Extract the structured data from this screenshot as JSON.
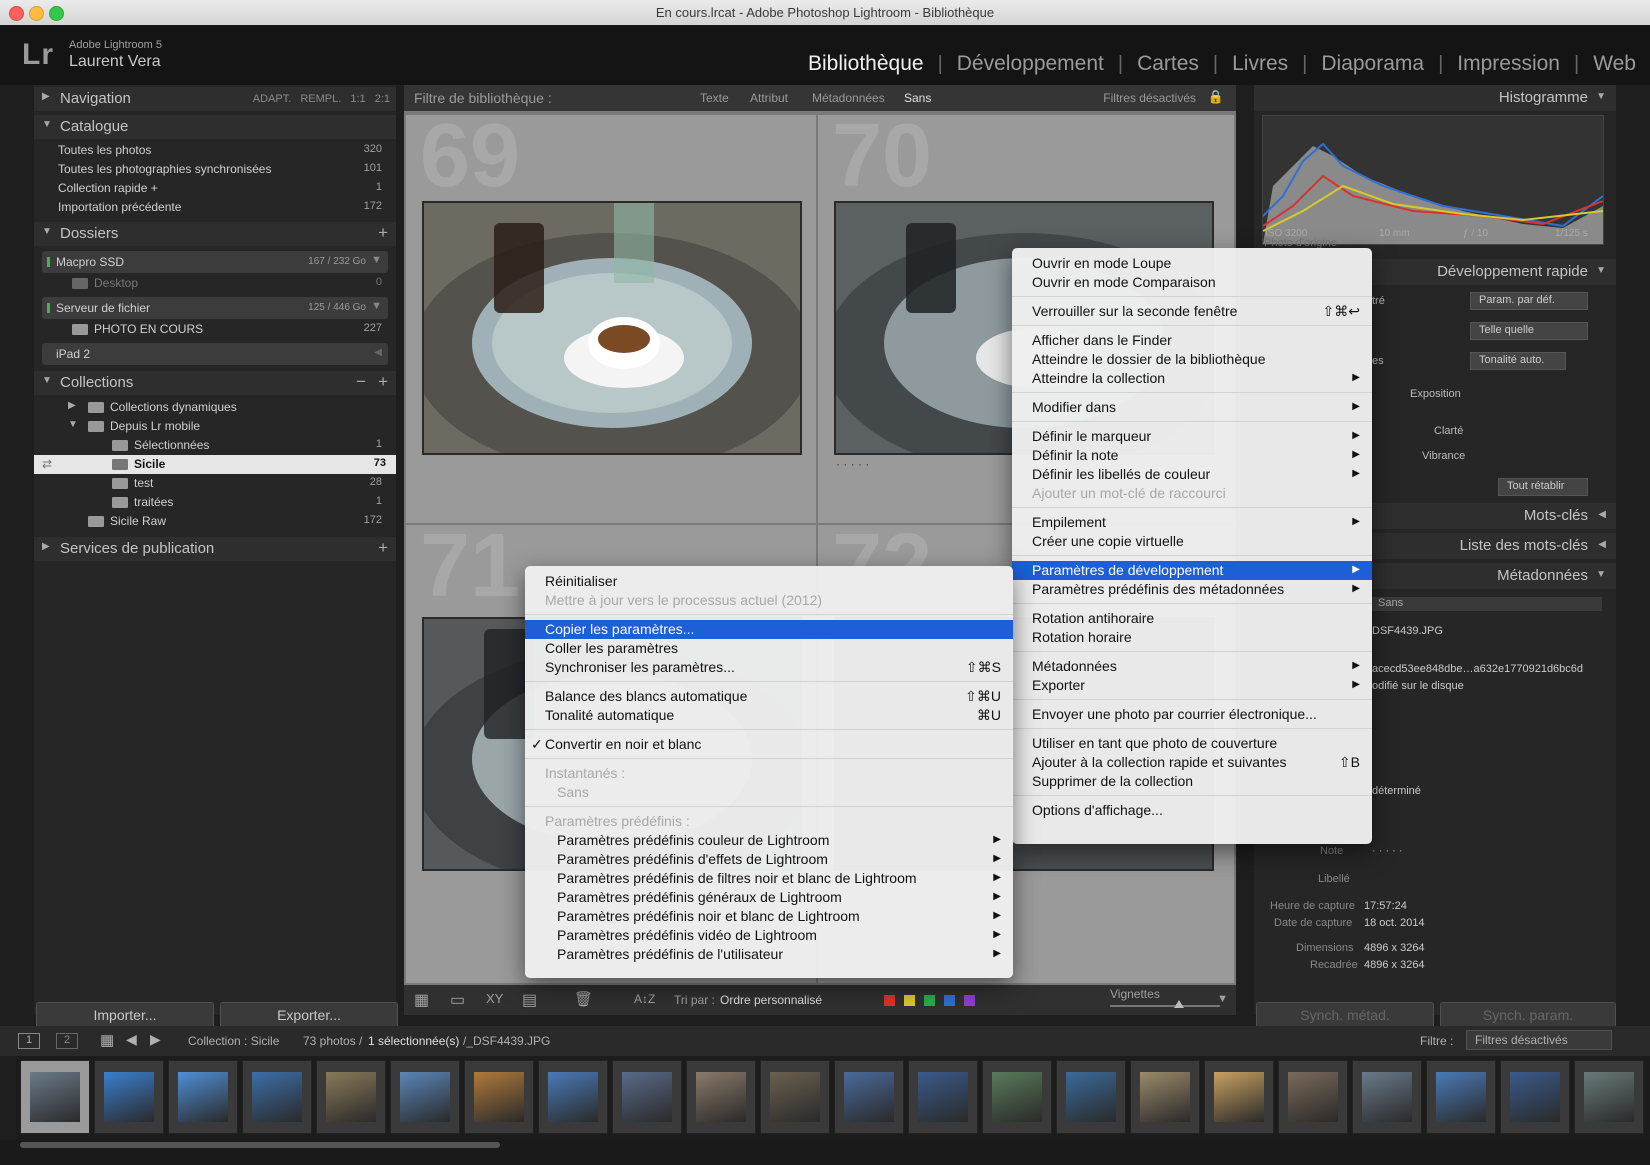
{
  "window": {
    "title": "En cours.lrcat - Adobe Photoshop Lightroom - Bibliothèque"
  },
  "identity": {
    "logo": "Lr",
    "product": "Adobe Lightroom 5",
    "user": "Laurent Vera"
  },
  "modules": [
    "Bibliothèque",
    "Développement",
    "Cartes",
    "Livres",
    "Diaporama",
    "Impression",
    "Web"
  ],
  "left": {
    "navigation": {
      "title": "Navigation",
      "options": "ADAPT. REMPL. 1:1 2:1"
    },
    "catalog": {
      "title": "Catalogue",
      "items": [
        {
          "label": "Toutes les photos",
          "count": "320"
        },
        {
          "label": "Toutes les photographies synchronisées",
          "count": "101"
        },
        {
          "label": "Collection rapide +",
          "count": "1"
        },
        {
          "label": "Importation précédente",
          "count": "172"
        }
      ]
    },
    "folders": {
      "title": "Dossiers",
      "items": [
        {
          "label": "Macpro SSD",
          "count": "167 / 232 Go"
        },
        {
          "label": "Desktop",
          "count": "0"
        },
        {
          "label": "Serveur de fichier",
          "count": "125 / 446 Go"
        },
        {
          "label": "PHOTO EN COURS",
          "count": "227"
        },
        {
          "label": "iPad 2",
          "count": ""
        }
      ]
    },
    "collections": {
      "title": "Collections",
      "items": [
        {
          "label": "Collections dynamiques",
          "count": ""
        },
        {
          "label": "Depuis Lr mobile",
          "count": ""
        },
        {
          "label": "Sélectionnées",
          "count": "1"
        },
        {
          "label": "Sicile",
          "count": "73"
        },
        {
          "label": "test",
          "count": "28"
        },
        {
          "label": "traitées",
          "count": "1"
        },
        {
          "label": "Sicile Raw",
          "count": "172"
        }
      ]
    },
    "publish": {
      "title": "Services de publication"
    },
    "import_label": "Importer...",
    "export_label": "Exporter..."
  },
  "filterbar": {
    "title": "Filtre de bibliothèque :",
    "tabs": [
      "Texte",
      "Attribut",
      "Métadonnées",
      "Sans"
    ],
    "status": "Filtres désactivés"
  },
  "grid": {
    "numbers": [
      "69",
      "70",
      "71",
      "72"
    ],
    "stars": "· · · · ·"
  },
  "toolbar": {
    "sort_label": "Tri par :",
    "sort_value": "Ordre personnalisé",
    "thumb_label": "Vignettes"
  },
  "right": {
    "histogram": {
      "title": "Histogramme",
      "iso": "ISO 3200",
      "focal": "10 mm",
      "aperture": "ƒ / 10",
      "shutter": "1/125 s",
      "original": "Photo d'origine"
    },
    "quick": {
      "title": "Développement rapide",
      "preset": "Param. par déf.",
      "crop": "Telle quelle",
      "tone": "Tonalité auto.",
      "exposure": "Exposition",
      "clarity": "Clarté",
      "vibrance": "Vibrance",
      "reset": "Tout rétablir",
      "partial": [
        "tré",
        "es"
      ]
    },
    "keywords": {
      "title": "Mots-clés"
    },
    "keywordlist": {
      "title": "Liste des mots-clés"
    },
    "metadata": {
      "title": "Métadonnées",
      "preset": "Sans",
      "filename": "DSF4439.JPG",
      "hash": "acecd53ee848dbe…a632e1770921d6bc6d",
      "status": "odifié sur le disque",
      "undetermined": "déterminé",
      "rating_label": "Note",
      "label_label": "Libellé",
      "capture_time_label": "Heure de capture",
      "capture_time": "17:57:24",
      "capture_date_label": "Date de capture",
      "capture_date": "18 oct. 2014",
      "dimensions_label": "Dimensions",
      "dimensions": "4896 x 3264",
      "cropped_label": "Recadrée",
      "cropped": "4896 x 3264"
    },
    "sync_meta": "Synch. métad.",
    "sync_param": "Synch. param."
  },
  "menu_main": [
    {
      "label": "Ouvrir en mode Loupe"
    },
    {
      "label": "Ouvrir en mode Comparaison"
    },
    {
      "sep": true
    },
    {
      "label": "Verrouiller sur la seconde fenêtre",
      "shortcut": "⇧⌘↩"
    },
    {
      "sep": true
    },
    {
      "label": "Afficher dans le Finder"
    },
    {
      "label": "Atteindre le dossier de la bibliothèque"
    },
    {
      "label": "Atteindre la collection",
      "arrow": "▶"
    },
    {
      "sep": true
    },
    {
      "label": "Modifier dans",
      "arrow": "▶"
    },
    {
      "sep": true
    },
    {
      "label": "Définir le marqueur",
      "arrow": "▶"
    },
    {
      "label": "Définir la note",
      "arrow": "▶"
    },
    {
      "label": "Définir les libellés de couleur",
      "arrow": "▶"
    },
    {
      "label": "Ajouter un mot-clé de raccourci",
      "disabled": true
    },
    {
      "sep": true
    },
    {
      "label": "Empilement",
      "arrow": "▶"
    },
    {
      "label": "Créer une copie virtuelle"
    },
    {
      "sep": true
    },
    {
      "label": "Paramètres de développement",
      "arrow": "▶",
      "highlight": true
    },
    {
      "label": "Paramètres prédéfinis des métadonnées",
      "arrow": "▶"
    },
    {
      "sep": true
    },
    {
      "label": "Rotation antihoraire"
    },
    {
      "label": "Rotation horaire"
    },
    {
      "sep": true
    },
    {
      "label": "Métadonnées",
      "arrow": "▶"
    },
    {
      "label": "Exporter",
      "arrow": "▶"
    },
    {
      "sep": true
    },
    {
      "label": "Envoyer une photo par courrier électronique..."
    },
    {
      "sep": true
    },
    {
      "label": "Utiliser en tant que photo de couverture"
    },
    {
      "label": "Ajouter à la collection rapide et suivantes",
      "shortcut": "⇧B"
    },
    {
      "label": "Supprimer de la collection"
    },
    {
      "sep": true
    },
    {
      "label": "Options d'affichage..."
    }
  ],
  "menu_sub": [
    {
      "label": "Réinitialiser"
    },
    {
      "label": "Mettre à jour vers le processus actuel (2012)",
      "disabled": true
    },
    {
      "sep": true
    },
    {
      "label": "Copier les paramètres...",
      "highlight": true
    },
    {
      "label": "Coller les paramètres"
    },
    {
      "label": "Synchroniser les paramètres...",
      "shortcut": "⇧⌘S"
    },
    {
      "sep": true
    },
    {
      "label": "Balance des blancs automatique",
      "shortcut": "⇧⌘U"
    },
    {
      "label": "Tonalité automatique",
      "shortcut": "⌘U"
    },
    {
      "sep": true
    },
    {
      "label": "Convertir en noir et blanc",
      "check": "✓"
    },
    {
      "sep": true
    },
    {
      "label": "Instantanés :",
      "disabled": true
    },
    {
      "label": "Sans",
      "disabled": true,
      "indent": true
    },
    {
      "sep": true
    },
    {
      "label": "Paramètres prédéfinis :",
      "disabled": true
    },
    {
      "label": "Paramètres prédéfinis couleur de Lightroom",
      "arrow": "▶",
      "indent": true
    },
    {
      "label": "Paramètres prédéfinis d'effets de Lightroom",
      "arrow": "▶",
      "indent": true
    },
    {
      "label": "Paramètres prédéfinis de filtres noir et blanc de Lightroom",
      "arrow": "▶",
      "indent": true
    },
    {
      "label": "Paramètres prédéfinis généraux de Lightroom",
      "arrow": "▶",
      "indent": true
    },
    {
      "label": "Paramètres prédéfinis noir et blanc de Lightroom",
      "arrow": "▶",
      "indent": true
    },
    {
      "label": "Paramètres prédéfinis vidéo de Lightroom",
      "arrow": "▶",
      "indent": true
    },
    {
      "label": "Paramètres prédéfinis de l'utilisateur",
      "arrow": "▶",
      "indent": true
    }
  ],
  "statusbar": {
    "view1": "1",
    "view2": "2",
    "source": "Collection : Sicile",
    "count_a": "73 photos /",
    "count_b": "1 sélectionnée(s)",
    "file": "/_DSF4439.JPG",
    "filter_label": "Filtre :",
    "filter_value": "Filtres désactivés"
  },
  "colors": {
    "accent": "#1c5fd6",
    "panel": "#262626",
    "grid": "#7a7a7a"
  }
}
